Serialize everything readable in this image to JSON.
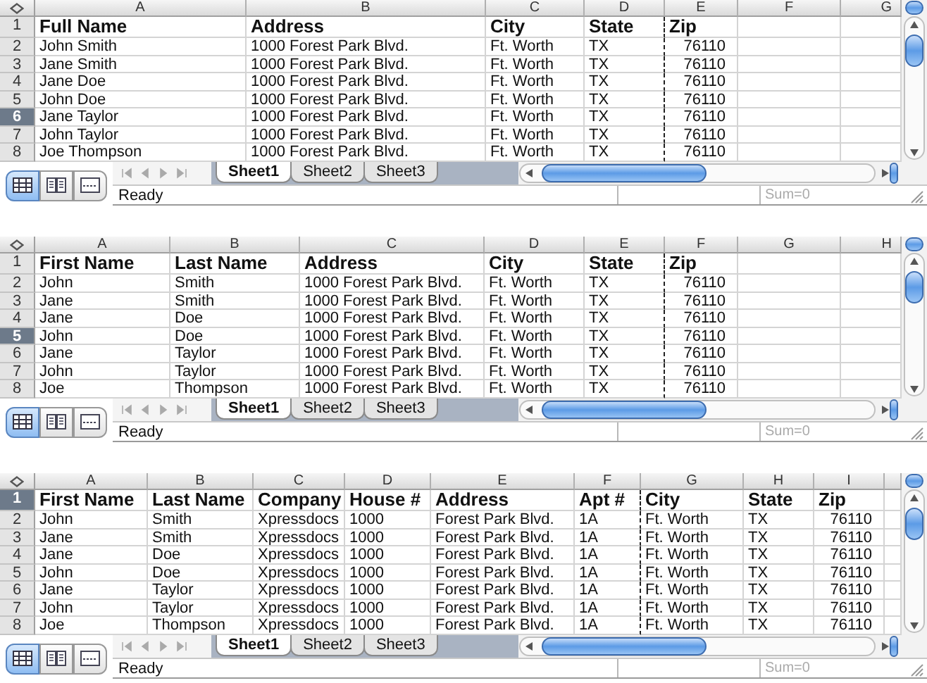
{
  "sheets": [
    {
      "columns": [
        {
          "letter": "A",
          "kind": "text"
        },
        {
          "letter": "B",
          "kind": "text"
        },
        {
          "letter": "C",
          "kind": "text"
        },
        {
          "letter": "D",
          "kind": "text",
          "page_break_after": true
        },
        {
          "letter": "E",
          "kind": "number"
        },
        {
          "letter": "F",
          "kind": "text"
        },
        {
          "letter": "G",
          "kind": "text"
        }
      ],
      "rows": [
        {
          "number": "1",
          "selected": false,
          "bold": true,
          "cells": [
            "Full Name",
            "Address",
            "City",
            "State",
            "Zip"
          ]
        },
        {
          "number": "2",
          "selected": false,
          "cells": [
            "John Smith",
            "1000 Forest Park Blvd.",
            "Ft. Worth",
            "TX",
            "76110"
          ]
        },
        {
          "number": "3",
          "selected": false,
          "cells": [
            "Jane Smith",
            "1000 Forest Park Blvd.",
            "Ft. Worth",
            "TX",
            "76110"
          ]
        },
        {
          "number": "4",
          "selected": false,
          "cells": [
            "Jane Doe",
            "1000 Forest Park Blvd.",
            "Ft. Worth",
            "TX",
            "76110"
          ]
        },
        {
          "number": "5",
          "selected": false,
          "cells": [
            "John Doe",
            "1000 Forest Park Blvd.",
            "Ft. Worth",
            "TX",
            "76110"
          ]
        },
        {
          "number": "6",
          "selected": true,
          "cells": [
            "Jane Taylor",
            "1000 Forest Park Blvd.",
            "Ft. Worth",
            "TX",
            "76110"
          ]
        },
        {
          "number": "7",
          "selected": false,
          "cells": [
            "John Taylor",
            "1000 Forest Park Blvd.",
            "Ft. Worth",
            "TX",
            "76110"
          ]
        },
        {
          "number": "8",
          "selected": false,
          "cells": [
            "Joe Thompson",
            "1000 Forest Park Blvd.",
            "Ft. Worth",
            "TX",
            "76110"
          ]
        }
      ],
      "views": [
        {
          "kind": "normal",
          "selected": true
        },
        {
          "kind": "layout",
          "selected": false
        },
        {
          "kind": "break",
          "selected": false
        }
      ],
      "tabs": [
        {
          "label": "Sheet1",
          "selected": true
        },
        {
          "label": "Sheet2",
          "selected": false
        },
        {
          "label": "Sheet3",
          "selected": false
        }
      ],
      "status": "Ready",
      "sum": "Sum=0"
    },
    {
      "columns": [
        {
          "letter": "A",
          "kind": "text"
        },
        {
          "letter": "B",
          "kind": "text"
        },
        {
          "letter": "C",
          "kind": "text"
        },
        {
          "letter": "D",
          "kind": "text"
        },
        {
          "letter": "E",
          "kind": "text",
          "page_break_after": true
        },
        {
          "letter": "F",
          "kind": "number"
        },
        {
          "letter": "G",
          "kind": "text"
        },
        {
          "letter": "H",
          "kind": "text"
        }
      ],
      "rows": [
        {
          "number": "1",
          "selected": false,
          "bold": true,
          "cells": [
            "First Name",
            "Last Name",
            "Address",
            "City",
            "State",
            "Zip"
          ]
        },
        {
          "number": "2",
          "selected": false,
          "cells": [
            "John",
            "Smith",
            "1000 Forest Park Blvd.",
            "Ft. Worth",
            "TX",
            "76110"
          ]
        },
        {
          "number": "3",
          "selected": false,
          "cells": [
            "Jane",
            "Smith",
            "1000 Forest Park Blvd.",
            "Ft. Worth",
            "TX",
            "76110"
          ]
        },
        {
          "number": "4",
          "selected": false,
          "cells": [
            "Jane",
            "Doe",
            "1000 Forest Park Blvd.",
            "Ft. Worth",
            "TX",
            "76110"
          ]
        },
        {
          "number": "5",
          "selected": true,
          "cells": [
            "John",
            "Doe",
            "1000 Forest Park Blvd.",
            "Ft. Worth",
            "TX",
            "76110"
          ]
        },
        {
          "number": "6",
          "selected": false,
          "cells": [
            "Jane",
            "Taylor",
            "1000 Forest Park Blvd.",
            "Ft. Worth",
            "TX",
            "76110"
          ]
        },
        {
          "number": "7",
          "selected": false,
          "cells": [
            "John",
            "Taylor",
            "1000 Forest Park Blvd.",
            "Ft. Worth",
            "TX",
            "76110"
          ]
        },
        {
          "number": "8",
          "selected": false,
          "cells": [
            "Joe",
            "Thompson",
            "1000 Forest Park Blvd.",
            "Ft. Worth",
            "TX",
            "76110"
          ]
        }
      ],
      "views": [
        {
          "kind": "normal",
          "selected": true
        },
        {
          "kind": "layout",
          "selected": false
        },
        {
          "kind": "break",
          "selected": false
        }
      ],
      "tabs": [
        {
          "label": "Sheet1",
          "selected": true
        },
        {
          "label": "Sheet2",
          "selected": false
        },
        {
          "label": "Sheet3",
          "selected": false
        }
      ],
      "status": "Ready",
      "sum": "Sum=0"
    },
    {
      "columns": [
        {
          "letter": "A",
          "kind": "text"
        },
        {
          "letter": "B",
          "kind": "text"
        },
        {
          "letter": "C",
          "kind": "text"
        },
        {
          "letter": "D",
          "kind": "text"
        },
        {
          "letter": "E",
          "kind": "text"
        },
        {
          "letter": "F",
          "kind": "text",
          "page_break_after": true
        },
        {
          "letter": "G",
          "kind": "text"
        },
        {
          "letter": "H",
          "kind": "text"
        },
        {
          "letter": "I",
          "kind": "number"
        }
      ],
      "rows": [
        {
          "number": "1",
          "selected": true,
          "bold": true,
          "cells": [
            "First Name",
            "Last Name",
            "Company",
            "House #",
            "Address",
            "Apt #",
            "City",
            "State",
            "Zip"
          ]
        },
        {
          "number": "2",
          "selected": false,
          "cells": [
            "John",
            "Smith",
            "Xpressdocs",
            "1000",
            "Forest Park Blvd.",
            "1A",
            "Ft. Worth",
            "TX",
            "76110"
          ]
        },
        {
          "number": "3",
          "selected": false,
          "cells": [
            "Jane",
            "Smith",
            "Xpressdocs",
            "1000",
            "Forest Park Blvd.",
            "1A",
            "Ft. Worth",
            "TX",
            "76110"
          ]
        },
        {
          "number": "4",
          "selected": false,
          "cells": [
            "Jane",
            "Doe",
            "Xpressdocs",
            "1000",
            "Forest Park Blvd.",
            "1A",
            "Ft. Worth",
            "TX",
            "76110"
          ]
        },
        {
          "number": "5",
          "selected": false,
          "cells": [
            "John",
            "Doe",
            "Xpressdocs",
            "1000",
            "Forest Park Blvd.",
            "1A",
            "Ft. Worth",
            "TX",
            "76110"
          ]
        },
        {
          "number": "6",
          "selected": false,
          "cells": [
            "Jane",
            "Taylor",
            "Xpressdocs",
            "1000",
            "Forest Park Blvd.",
            "1A",
            "Ft. Worth",
            "TX",
            "76110"
          ]
        },
        {
          "number": "7",
          "selected": false,
          "cells": [
            "John",
            "Taylor",
            "Xpressdocs",
            "1000",
            "Forest Park Blvd.",
            "1A",
            "Ft. Worth",
            "TX",
            "76110"
          ]
        },
        {
          "number": "8",
          "selected": false,
          "cells": [
            "Joe",
            "Thompson",
            "Xpressdocs",
            "1000",
            "Forest Park Blvd.",
            "1A",
            "Ft. Worth",
            "TX",
            "76110"
          ]
        }
      ],
      "views": [
        {
          "kind": "normal",
          "selected": true
        },
        {
          "kind": "layout",
          "selected": false
        },
        {
          "kind": "break",
          "selected": false
        }
      ],
      "tabs": [
        {
          "label": "Sheet1",
          "selected": true
        },
        {
          "label": "Sheet2",
          "selected": false
        },
        {
          "label": "Sheet3",
          "selected": false
        }
      ],
      "status": "Ready",
      "sum": "Sum=0"
    }
  ]
}
